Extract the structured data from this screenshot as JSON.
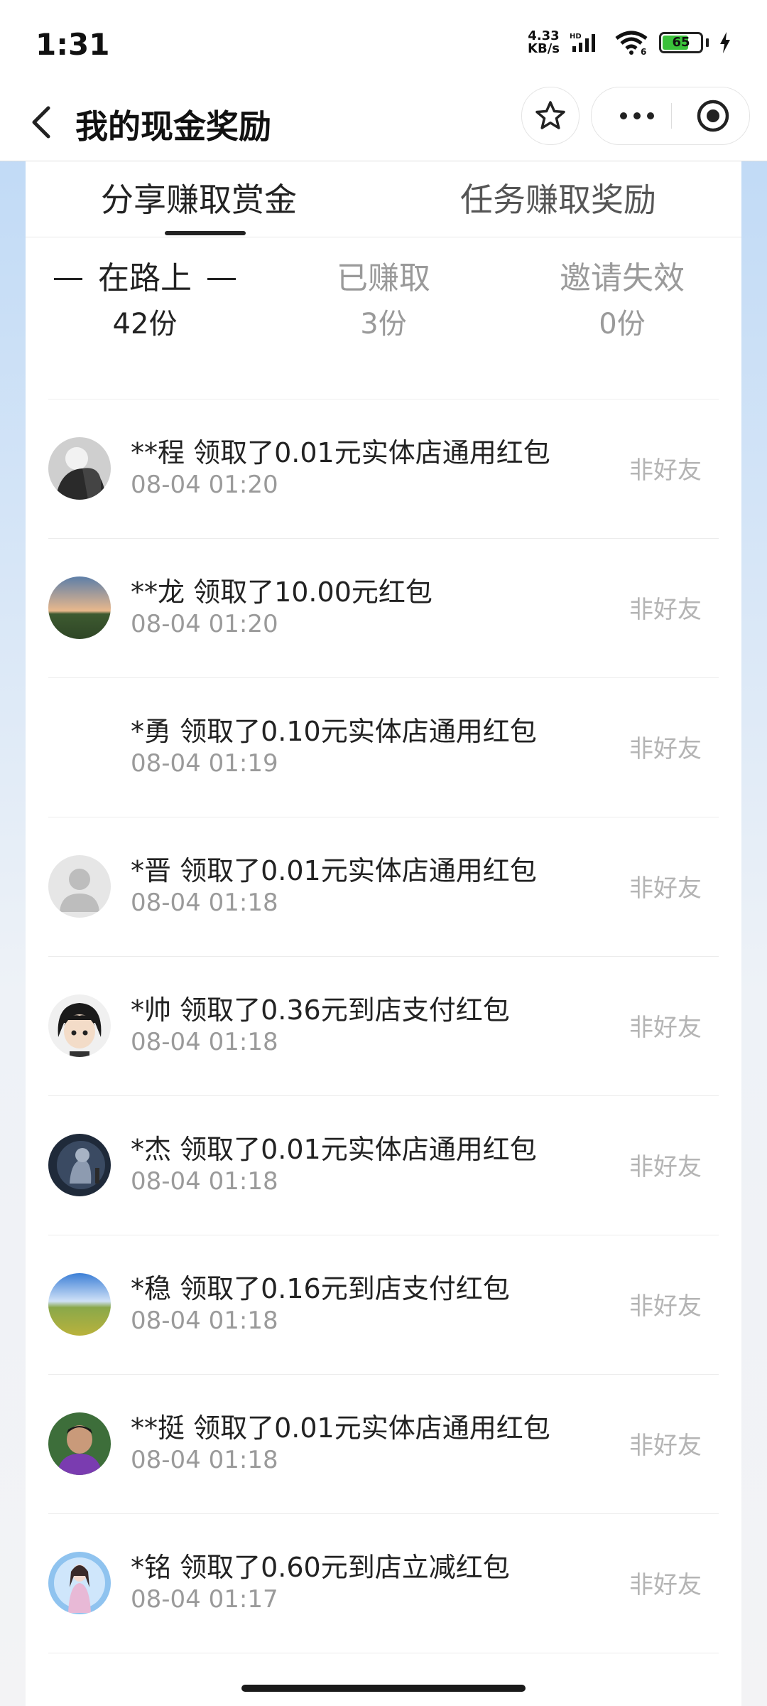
{
  "status_bar": {
    "time": "1:31",
    "net_speed_value": "4.33",
    "net_speed_unit": "KB/s",
    "hd": "HD",
    "wifi_badge": "6",
    "battery": "65"
  },
  "nav": {
    "title": "我的现金奖励"
  },
  "tabs": [
    {
      "label": "分享赚取赏金",
      "active": true
    },
    {
      "label": "任务赚取奖励",
      "active": false
    }
  ],
  "stats": [
    {
      "label": "在路上",
      "count": "42份",
      "active": true
    },
    {
      "label": "已赚取",
      "count": "3份",
      "active": false
    },
    {
      "label": "邀请失效",
      "count": "0份",
      "active": false
    }
  ],
  "records": [
    {
      "name": "**程 领取了0.01元实体店通用红包",
      "time": "08-04 01:20",
      "tag": "非好友",
      "avatar": "dark-photo"
    },
    {
      "name": "**龙 领取了10.00元红包",
      "time": "08-04 01:20",
      "tag": "非好友",
      "avatar": "sunset"
    },
    {
      "name": "*勇 领取了0.10元实体店通用红包",
      "time": "08-04 01:19",
      "tag": "非好友",
      "avatar": "blank"
    },
    {
      "name": "*晋 领取了0.01元实体店通用红包",
      "time": "08-04 01:18",
      "tag": "非好友",
      "avatar": "default"
    },
    {
      "name": "*帅 领取了0.36元到店支付红包",
      "time": "08-04 01:18",
      "tag": "非好友",
      "avatar": "anime"
    },
    {
      "name": "*杰 领取了0.01元实体店通用红包",
      "time": "08-04 01:18",
      "tag": "非好友",
      "avatar": "night"
    },
    {
      "name": "*稳 领取了0.16元到店支付红包",
      "time": "08-04 01:18",
      "tag": "非好友",
      "avatar": "field"
    },
    {
      "name": "**挺 领取了0.01元实体店通用红包",
      "time": "08-04 01:18",
      "tag": "非好友",
      "avatar": "portrait"
    },
    {
      "name": "*铭 领取了0.60元到店立减红包",
      "time": "08-04 01:17",
      "tag": "非好友",
      "avatar": "fantasy"
    }
  ]
}
